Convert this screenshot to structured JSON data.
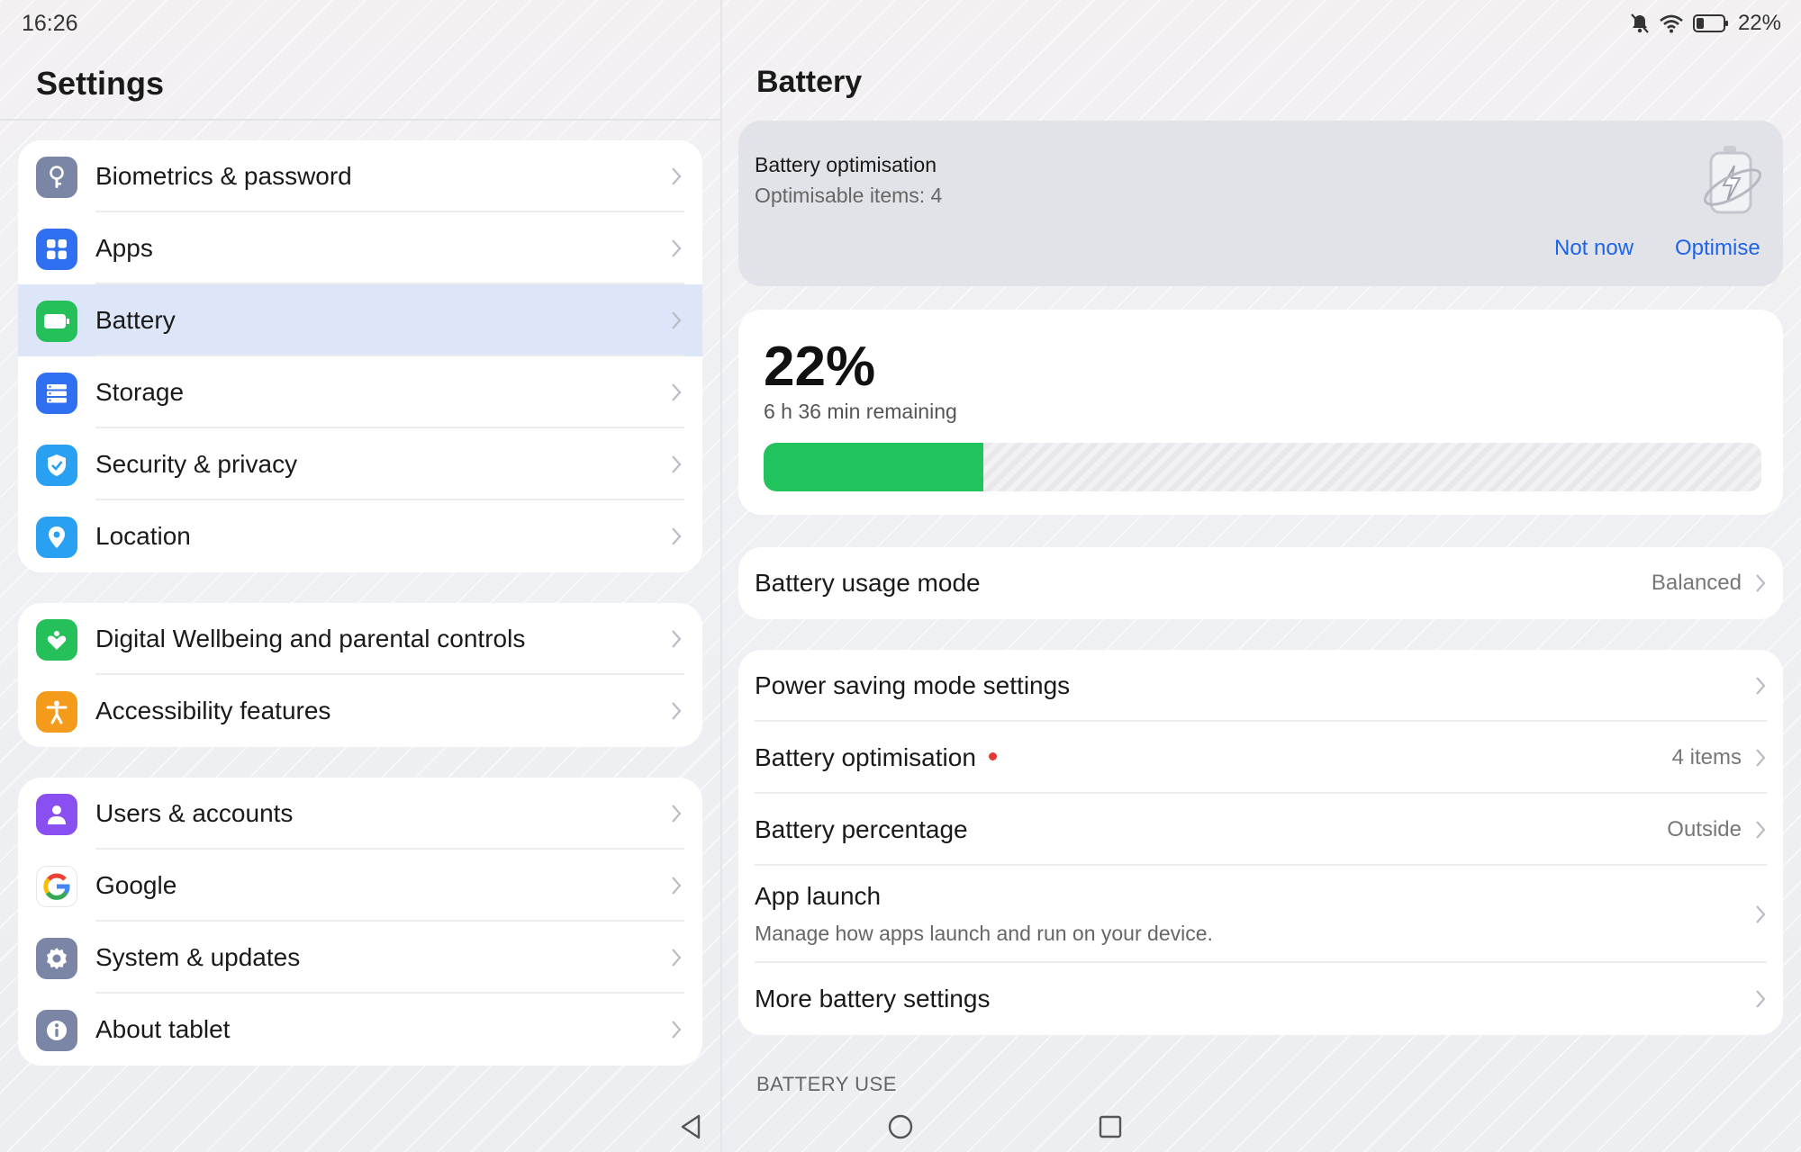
{
  "status_bar": {
    "time": "16:26",
    "battery_pct": "22%"
  },
  "left": {
    "title": "Settings",
    "groups": [
      [
        {
          "label": "Biometrics & password",
          "icon": "key-icon",
          "color": "#7b86a6"
        },
        {
          "label": "Apps",
          "icon": "apps-grid-icon",
          "color": "#2f6ff0"
        },
        {
          "label": "Battery",
          "icon": "battery-icon",
          "color": "#25c05a",
          "active": true
        },
        {
          "label": "Storage",
          "icon": "storage-icon",
          "color": "#2f6ff0"
        },
        {
          "label": "Security & privacy",
          "icon": "shield-check-icon",
          "color": "#2aa0f3"
        },
        {
          "label": "Location",
          "icon": "location-pin-icon",
          "color": "#2aa0f3"
        }
      ],
      [
        {
          "label": "Digital Wellbeing and parental controls",
          "icon": "wellbeing-heart-icon",
          "color": "#25c05a"
        },
        {
          "label": "Accessibility features",
          "icon": "accessibility-icon",
          "color": "#f59b1c"
        }
      ],
      [
        {
          "label": "Users & accounts",
          "icon": "user-icon",
          "color": "#8a4ff0"
        },
        {
          "label": "Google",
          "icon": "google-g-icon",
          "color": "#ffffff"
        },
        {
          "label": "System & updates",
          "icon": "gear-icon",
          "color": "#7b86a6"
        },
        {
          "label": "About tablet",
          "icon": "info-icon",
          "color": "#7b86a6"
        }
      ]
    ]
  },
  "right": {
    "title": "Battery",
    "optimisation_card": {
      "title": "Battery optimisation",
      "subtitle": "Optimisable items: 4",
      "not_now": "Not now",
      "optimise": "Optimise"
    },
    "battery": {
      "percent_text": "22%",
      "remaining": "6 h 36 min remaining",
      "level": 0.22
    },
    "usage_mode": {
      "label": "Battery usage mode",
      "value": "Balanced"
    },
    "settings": {
      "power_saving": {
        "label": "Power saving mode settings"
      },
      "optimisation": {
        "label": "Battery optimisation",
        "value": "4 items"
      },
      "percentage": {
        "label": "Battery percentage",
        "value": "Outside"
      },
      "app_launch": {
        "label": "App launch",
        "sub": "Manage how apps launch and run on your device."
      },
      "more": {
        "label": "More battery settings"
      }
    },
    "section_header": "BATTERY USE"
  },
  "colors": {
    "accent": "#1e64e6",
    "battery_green": "#21c35c",
    "active_row": "#dde6f8"
  }
}
